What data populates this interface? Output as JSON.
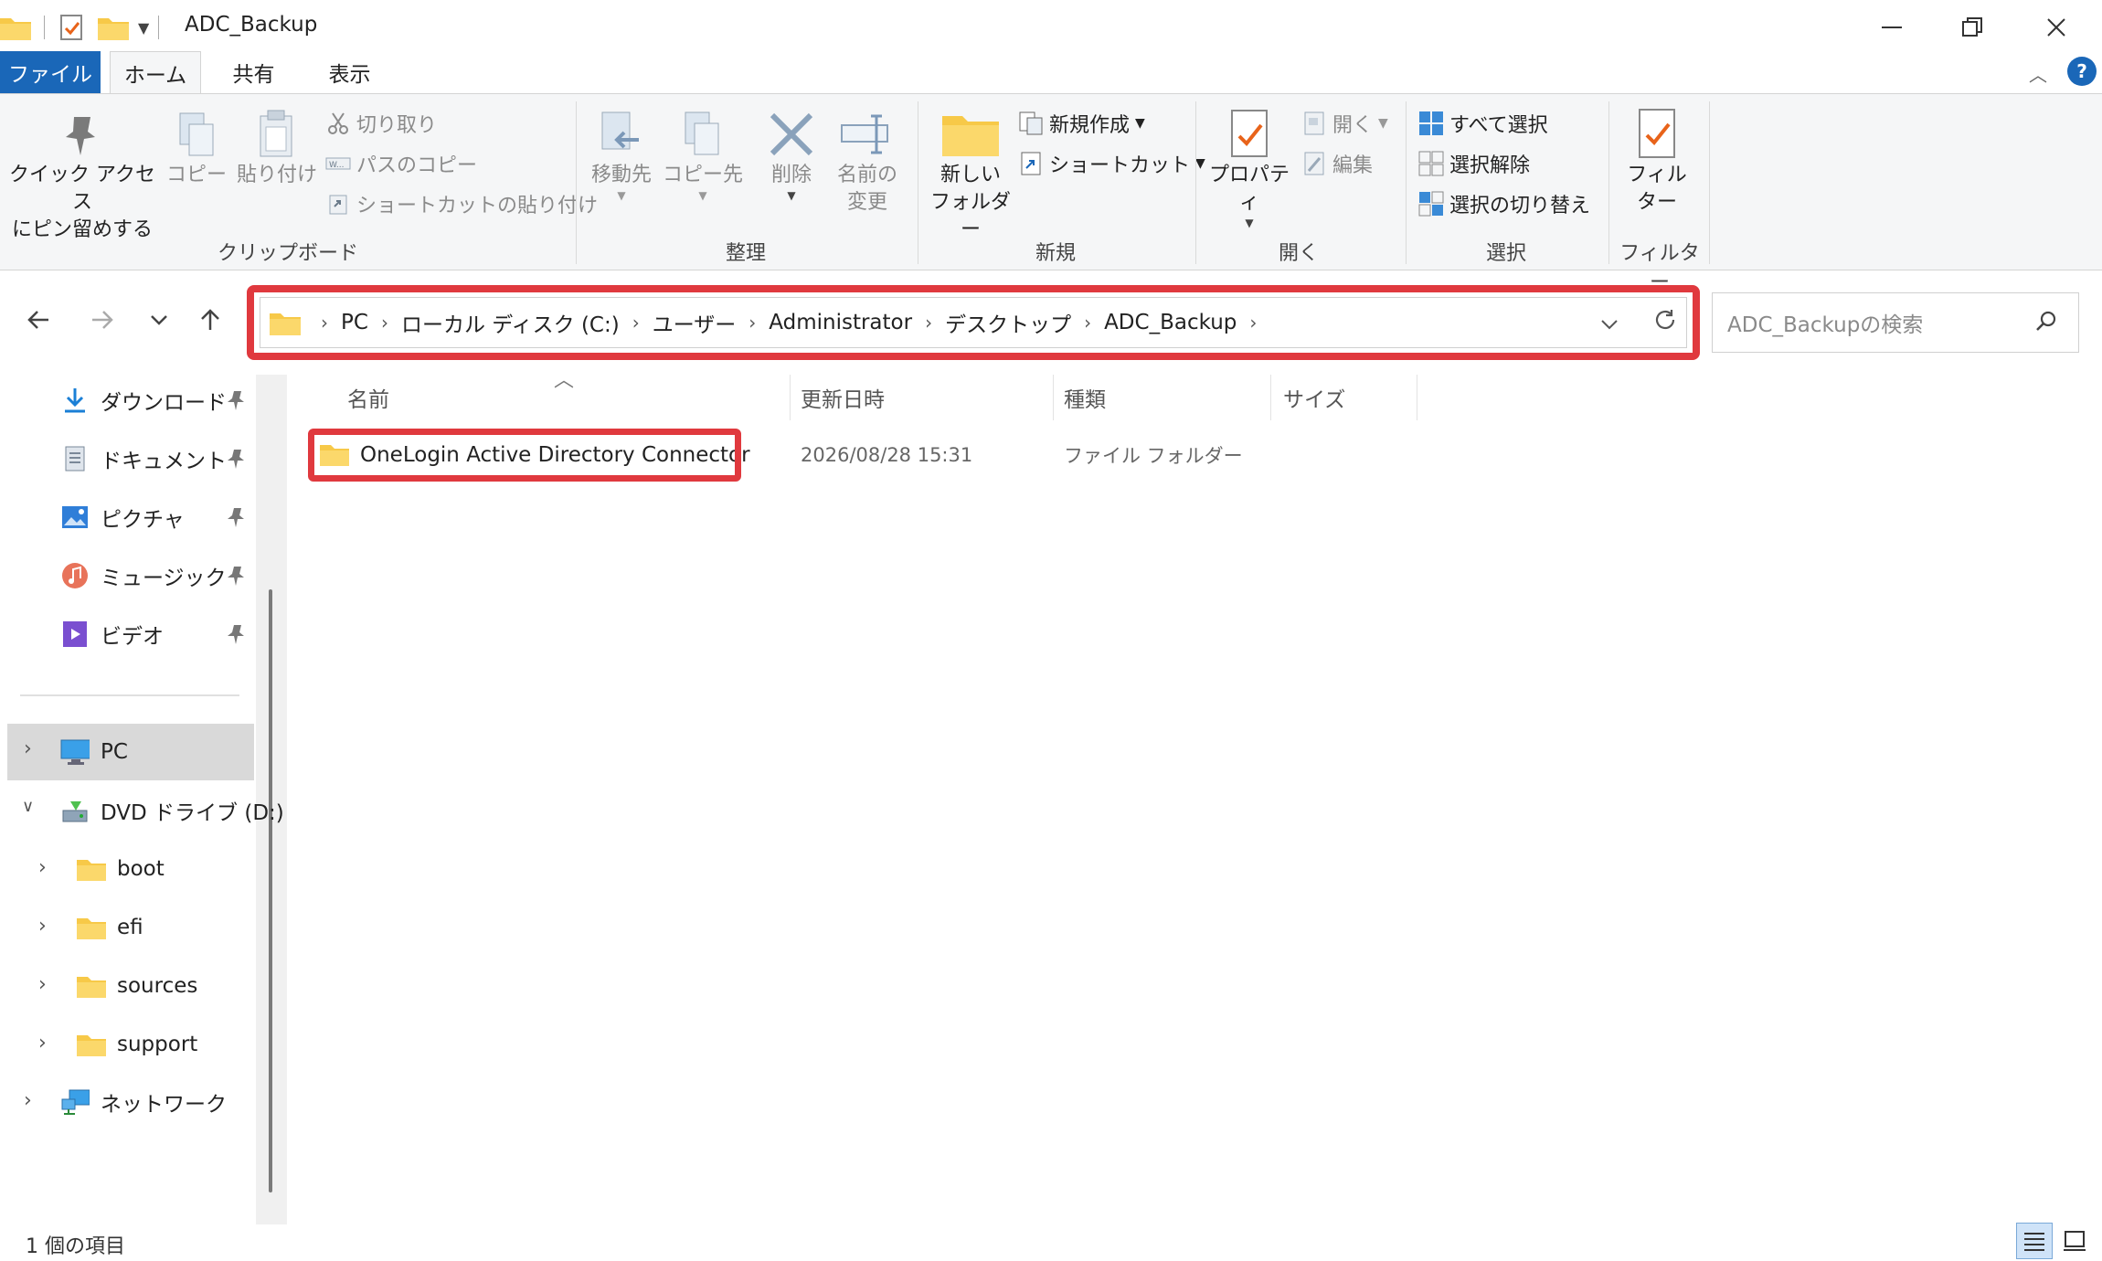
{
  "window": {
    "title": "ADC_Backup"
  },
  "ribbon_tabs": [
    "ファイル",
    "ホーム",
    "共有",
    "表示"
  ],
  "ribbon": {
    "clipboard": {
      "pin": "クイック アクセス\nにピン留めする",
      "copy": "コピー",
      "paste": "貼り付け",
      "cut": "切り取り",
      "copy_path": "パスのコピー",
      "paste_shortcut": "ショートカットの貼り付け",
      "label": "クリップボード"
    },
    "organize": {
      "move_to": "移動先",
      "copy_to": "コピー先",
      "delete": "削除",
      "rename": "名前の\n変更",
      "label": "整理"
    },
    "new": {
      "new_folder": "新しい\nフォルダー",
      "new_item": "新規作成",
      "shortcut": "ショートカット",
      "label": "新規"
    },
    "open": {
      "properties": "プロパティ",
      "open": "開く",
      "edit": "編集",
      "label": "開く"
    },
    "select": {
      "select_all": "すべて選択",
      "select_none": "選択解除",
      "invert": "選択の切り替え",
      "label": "選択"
    },
    "filter": {
      "filter": "フィル\nター",
      "label": "フィルター"
    }
  },
  "address": {
    "crumbs": [
      "PC",
      "ローカル ディスク (C:)",
      "ユーザー",
      "Administrator",
      "デスクトップ",
      "ADC_Backup"
    ]
  },
  "search": {
    "placeholder": "ADC_Backupの検索"
  },
  "sidebar": {
    "quick": [
      {
        "label": "ダウンロード",
        "icon": "download-icon"
      },
      {
        "label": "ドキュメント",
        "icon": "document-icon"
      },
      {
        "label": "ピクチャ",
        "icon": "picture-icon"
      },
      {
        "label": "ミュージック",
        "icon": "music-icon"
      },
      {
        "label": "ビデオ",
        "icon": "video-icon"
      }
    ],
    "pc": "PC",
    "dvd": "DVD ドライブ (D:)",
    "dvd_children": [
      "boot",
      "efi",
      "sources",
      "support"
    ],
    "network": "ネットワーク"
  },
  "columns": {
    "name": "名前",
    "modified": "更新日時",
    "type": "種類",
    "size": "サイズ"
  },
  "files": [
    {
      "name": "OneLogin Active Directory Connector",
      "modified": "2026/08/28 15:31",
      "type": "ファイル フォルダー",
      "size": ""
    }
  ],
  "status": {
    "count": "1 個の項目"
  },
  "colors": {
    "accent": "#1a67b8",
    "highlight": "#e0393e",
    "folder": "#f7c948"
  }
}
